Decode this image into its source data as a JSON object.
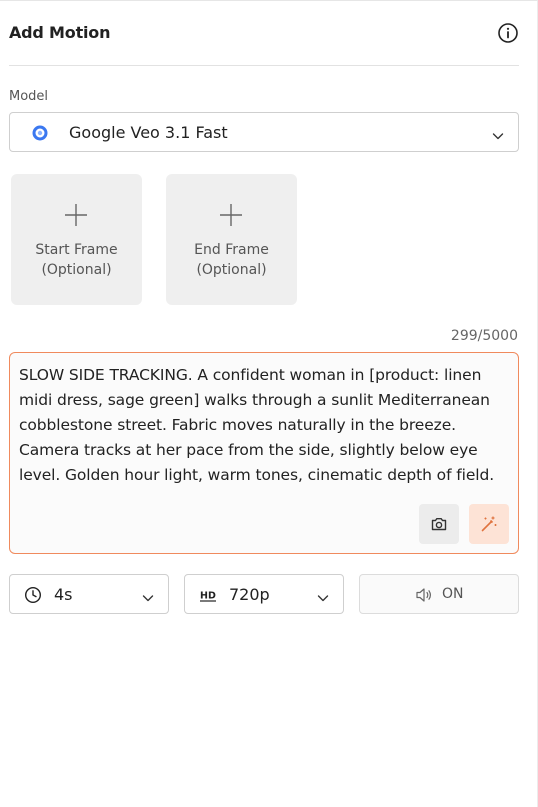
{
  "header": {
    "title": "Add Motion",
    "info_icon": "info-icon"
  },
  "model": {
    "label": "Model",
    "selected": "Google Veo 3.1 Fast",
    "logo_icon": "google-veo-logo",
    "logo_color": "#3b78f0"
  },
  "frames": [
    {
      "line1": "Start Frame",
      "line2": "(Optional)"
    },
    {
      "line1": "End Frame",
      "line2": "(Optional)"
    }
  ],
  "prompt": {
    "counter": "299/5000",
    "text": "SLOW SIDE TRACKING. A confident woman in [product: linen midi dress, sage green] walks through a sunlit Mediterranean cobblestone street. Fabric moves naturally in the breeze. Camera tracks at her pace from the side, slightly below eye level. Golden hour light, warm tones, cinematic depth of field.",
    "border_color": "#f08a5d"
  },
  "controls": {
    "duration": {
      "value": "4s",
      "icon": "clock-icon"
    },
    "resolution": {
      "value": "720p",
      "icon": "hd-icon"
    },
    "audio": {
      "label": "ON",
      "icon": "speaker-icon"
    }
  },
  "colors": {
    "accent": "#f08a5d",
    "accent_light": "#fde3d6"
  }
}
